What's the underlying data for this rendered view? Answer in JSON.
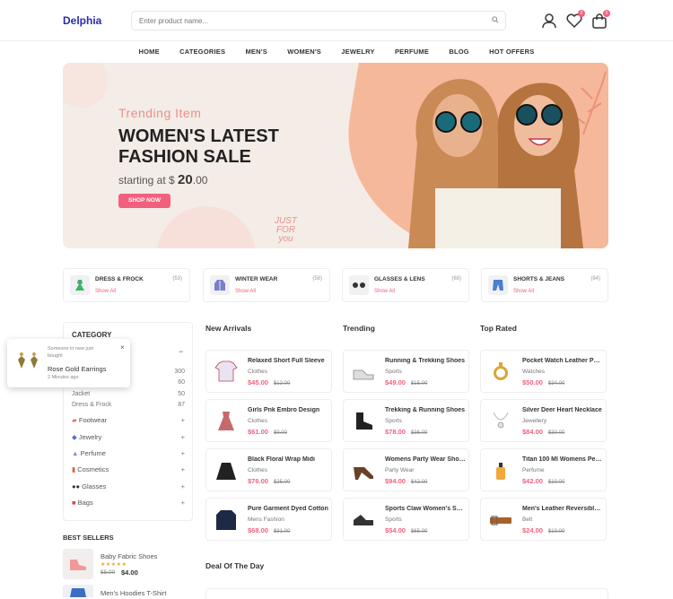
{
  "header": {
    "logo": "Delphia",
    "search_placeholder": "Enter product name...",
    "wishlist_badge": "0",
    "cart_badge": "0"
  },
  "nav": [
    "HOME",
    "CATEGORIES",
    "MEN'S",
    "WOMEN'S",
    "JEWELRY",
    "PERFUME",
    "BLOG",
    "HOT OFFERS"
  ],
  "banner": {
    "subtitle": "Trending Item",
    "title_line1": "WOMEN'S LATEST",
    "title_line2": "FASHION SALE",
    "price_prefix": "starting at $",
    "price_main": "20",
    "price_cents": ".00",
    "button": "SHOP NOW",
    "sticker_line1": "JUST",
    "sticker_line2": "FOR",
    "sticker_line3": "you"
  },
  "categories": [
    {
      "name": "DRESS & FROCK",
      "count": "(53)",
      "link": "Show All"
    },
    {
      "name": "WINTER WEAR",
      "count": "(58)",
      "link": "Show All"
    },
    {
      "name": "GLASSES & LENS",
      "count": "(68)",
      "link": "Show All"
    },
    {
      "name": "SHORTS & JEANS",
      "count": "(84)",
      "link": "Show All"
    }
  ],
  "sidebar": {
    "title": "CATEGORY",
    "sub_counts": [
      "300",
      "60",
      "50",
      "87"
    ],
    "sub_items": [
      "Jacket",
      "Dress & Frock"
    ],
    "items": [
      "Footwear",
      "Jewelry",
      "Perfume",
      "Cosmetics",
      "Glasses",
      "Bags"
    ]
  },
  "popup": {
    "line1": "Someone in new just",
    "line2": "bought",
    "product": "Rose Gold Earrings",
    "time": "2 Minutes ago",
    "close": "×"
  },
  "best_sellers": {
    "title": "BEST SELLERS",
    "items": [
      {
        "name": "Baby Fabric Shoes",
        "stars": "★★★★★",
        "old": "$5.00",
        "price": "$4.00"
      },
      {
        "name": "Men's Hoodies T-Shirt"
      }
    ]
  },
  "columns": [
    {
      "title": "New Arrivals",
      "products": [
        {
          "name": "Relaxed Short Full Sleeve",
          "cat": "Clothes",
          "price": "$45.00",
          "old": "$12.00"
        },
        {
          "name": "Girls Pnk Embro Design",
          "cat": "Clothes",
          "price": "$61.00",
          "old": "$9.00"
        },
        {
          "name": "Black Floral Wrap Midi",
          "cat": "Clothes",
          "price": "$76.00",
          "old": "$25.00"
        },
        {
          "name": "Pure Garment Dyed Cotton",
          "cat": "Mens Fashion",
          "price": "$68.00",
          "old": "$31.00"
        }
      ]
    },
    {
      "title": "Trending",
      "products": [
        {
          "name": "Running & Trekking Shoes",
          "cat": "Sports",
          "price": "$49.00",
          "old": "$15.00"
        },
        {
          "name": "Trekking & Running Shoes",
          "cat": "Sports",
          "price": "$78.00",
          "old": "$36.00"
        },
        {
          "name": "Womens Party Wear Shoes",
          "cat": "Party Wear",
          "price": "$94.00",
          "old": "$42.00"
        },
        {
          "name": "Sports Claw Women's Shoes",
          "cat": "Sports",
          "price": "$54.00",
          "old": "$65.00"
        }
      ]
    },
    {
      "title": "Top Rated",
      "products": [
        {
          "name": "Pocket Watch Leather Pouch",
          "cat": "Watches",
          "price": "$50.00",
          "old": "$34.00"
        },
        {
          "name": "Silver Deer Heart Necklace",
          "cat": "Jewellery",
          "price": "$84.00",
          "old": "$30.00"
        },
        {
          "name": "Titan 100 Ml Womens Perfume",
          "cat": "Perfume",
          "price": "$42.00",
          "old": "$10.00"
        },
        {
          "name": "Men's Leather Reversible Belt",
          "cat": "Belt",
          "price": "$24.00",
          "old": "$10.00"
        }
      ]
    }
  ],
  "deal_title": "Deal Of The Day",
  "colors": {
    "accent": "#f1617e",
    "brand": "#2a2ab0"
  }
}
